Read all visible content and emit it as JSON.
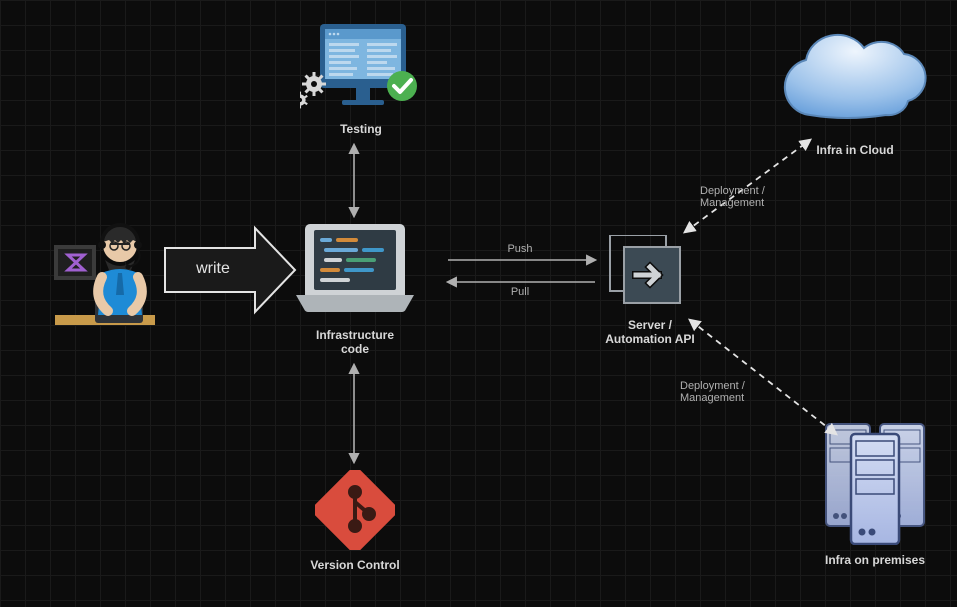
{
  "diagram": {
    "nodes": {
      "developer": {
        "label": ""
      },
      "testing": {
        "label": "Testing"
      },
      "infra_code": {
        "label": "Infrastructure\ncode"
      },
      "version_control": {
        "label": "Version Control"
      },
      "server_api": {
        "label": "Server /\nAutomation API"
      },
      "infra_cloud": {
        "label": "Infra in Cloud"
      },
      "infra_onprem": {
        "label": "Infra on premises"
      }
    },
    "edges": {
      "write": {
        "label": "write"
      },
      "push_pull": {
        "push": "Push",
        "pull": "Pull"
      },
      "deploy_cloud": {
        "label": "Deployment /\nManagement"
      },
      "deploy_onprem": {
        "label": "Deployment /\nManagement"
      }
    }
  }
}
